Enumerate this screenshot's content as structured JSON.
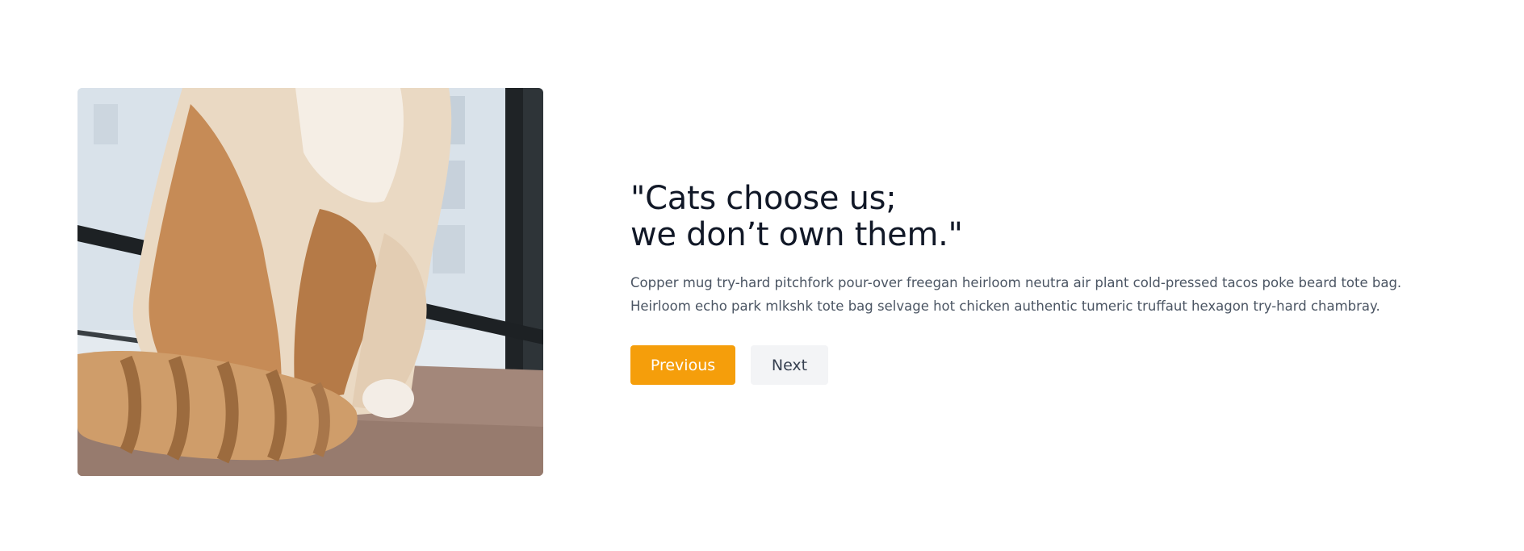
{
  "testimonial": {
    "image_alt": "Cat photo",
    "headline_line1": "\"Cats choose us;",
    "headline_line2": "we don’t own them.\"",
    "description_line1": "Copper mug try-hard pitchfork pour-over freegan heirloom neutra air plant cold-pressed tacos poke beard tote bag.",
    "description_line2": "Heirloom echo park mlkshk tote bag selvage hot chicken authentic tumeric truffaut hexagon try-hard chambray."
  },
  "buttons": {
    "previous_label": "Previous",
    "next_label": "Next"
  },
  "colors": {
    "accent": "#f59e0b",
    "secondary_button": "#f3f4f6",
    "heading": "#111827",
    "body_text": "#4b5563"
  }
}
